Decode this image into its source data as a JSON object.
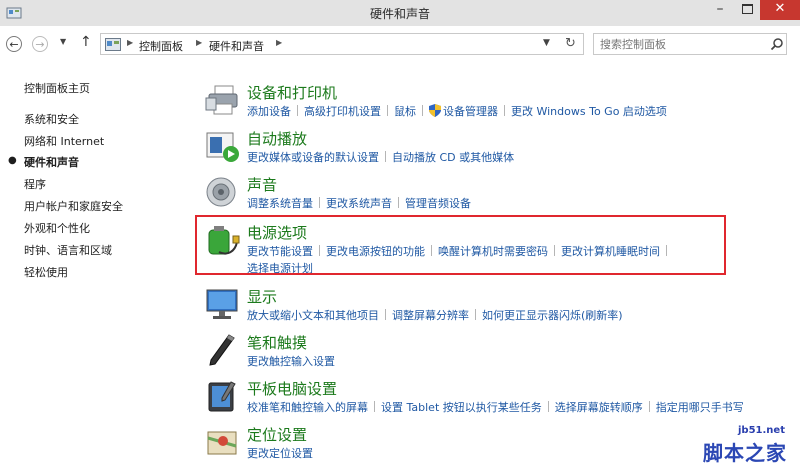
{
  "window": {
    "title": "硬件和声音"
  },
  "address": {
    "crumbs": [
      "控制面板",
      "硬件和声音"
    ],
    "search_placeholder": "搜索控制面板"
  },
  "sidebar": {
    "home": "控制面板主页",
    "items": [
      "系统和安全",
      "网络和 Internet",
      "硬件和声音",
      "程序",
      "用户帐户和家庭安全",
      "外观和个性化",
      "时钟、语言和区域",
      "轻松使用"
    ]
  },
  "categories": {
    "devices": {
      "title": "设备和打印机",
      "links": [
        "添加设备",
        "高级打印机设置",
        "鼠标",
        "设备管理器",
        "更改 Windows To Go 启动选项"
      ]
    },
    "autoplay": {
      "title": "自动播放",
      "links": [
        "更改媒体或设备的默认设置",
        "自动播放 CD 或其他媒体"
      ]
    },
    "sound": {
      "title": "声音",
      "links": [
        "调整系统音量",
        "更改系统声音",
        "管理音频设备"
      ]
    },
    "power": {
      "title": "电源选项",
      "links": [
        "更改节能设置",
        "更改电源按钮的功能",
        "唤醒计算机时需要密码",
        "更改计算机睡眠时间",
        "选择电源计划"
      ]
    },
    "display": {
      "title": "显示",
      "links": [
        "放大或缩小文本和其他项目",
        "调整屏幕分辨率",
        "如何更正显示器闪烁(刷新率)"
      ]
    },
    "pen": {
      "title": "笔和触摸",
      "links": [
        "更改触控输入设置"
      ]
    },
    "tablet": {
      "title": "平板电脑设置",
      "links": [
        "校准笔和触控输入的屏幕",
        "设置 Tablet 按钮以执行某些任务",
        "选择屏幕旋转顺序",
        "指定用哪只手书写"
      ]
    },
    "location": {
      "title": "定位设置",
      "links": [
        "更改定位设置"
      ]
    }
  },
  "watermark": {
    "url": "jb51.net",
    "name": "脚本之家"
  },
  "colors": {
    "title_green": "#1c7a1c",
    "link_blue": "#1f58a3",
    "highlight_red": "#e0272e",
    "close_red": "#c7372f"
  }
}
